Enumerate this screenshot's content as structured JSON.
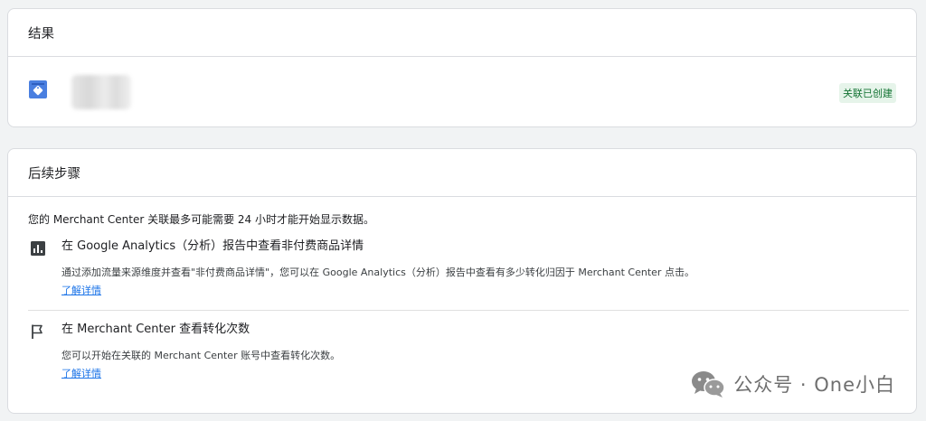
{
  "result_card": {
    "title": "结果",
    "status_badge": "关联已创建"
  },
  "next_steps_card": {
    "title": "后续步骤",
    "intro": "您的 Merchant Center 关联最多可能需要 24 小时才能开始显示数据。",
    "steps": [
      {
        "icon": "bar-chart-icon",
        "title": "在 Google Analytics（分析）报告中查看非付费商品详情",
        "description": "通过添加流量来源维度并查看\"非付费商品详情\"，您可以在 Google Analytics（分析）报告中查看有多少转化归因于 Merchant Center 点击。",
        "link": "了解详情"
      },
      {
        "icon": "flag-icon",
        "title": "在 Merchant Center 查看转化次数",
        "description": "您可以开始在关联的 Merchant Center 账号中查看转化次数。",
        "link": "了解详情"
      }
    ]
  },
  "watermark": {
    "text": "公众号 · One小白",
    "icon": "wechat-icon"
  },
  "colors": {
    "badge_bg": "#e6f4ea",
    "badge_text": "#137333",
    "link": "#1a73e8",
    "product_icon": "#4285f4"
  }
}
